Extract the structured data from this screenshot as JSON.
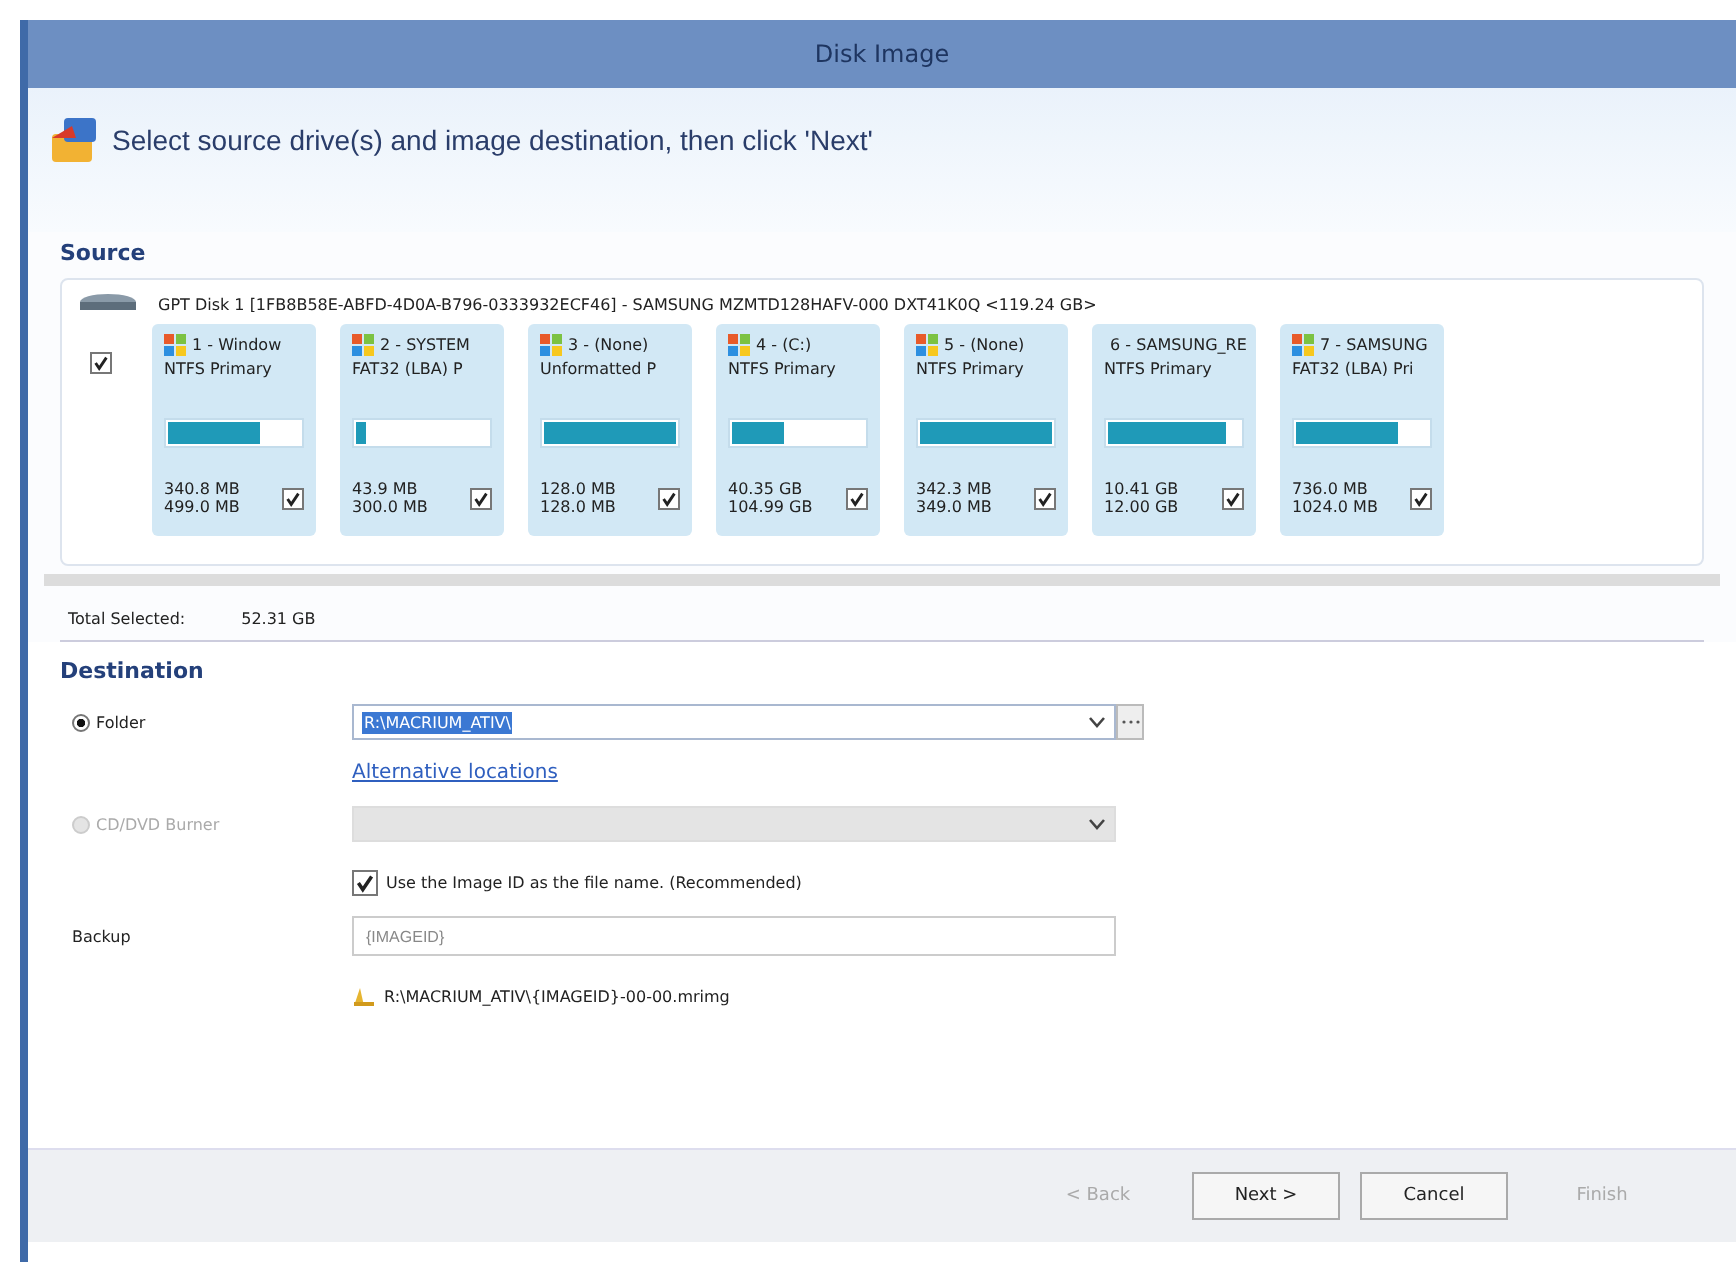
{
  "window": {
    "title": "Disk Image"
  },
  "header": {
    "instruction": "Select source drive(s) and image destination, then click 'Next'"
  },
  "source": {
    "heading": "Source",
    "disk": {
      "label": "GPT Disk 1 [1FB8B58E-ABFD-4D0A-B796-0333932ECF46] - SAMSUNG MZMTD128HAFV-000 DXT41K0Q  <119.24 GB>",
      "checked": true,
      "partitions": [
        {
          "name": "1 - Window",
          "type": "NTFS Primary",
          "level": 0.7,
          "used": "340.8 MB",
          "total": "499.0 MB",
          "checked": true
        },
        {
          "name": "2 - SYSTEM",
          "type": "FAT32 (LBA) P",
          "level": 0.08,
          "used": "43.9 MB",
          "total": "300.0 MB",
          "checked": true
        },
        {
          "name": "3 - (None)",
          "type": "Unformatted P",
          "level": 1,
          "used": "128.0 MB",
          "total": "128.0 MB",
          "checked": true
        },
        {
          "name": "4 - (C:)",
          "type": "NTFS Primary",
          "level": 0.4,
          "used": "40.35 GB",
          "total": "104.99 GB",
          "checked": true
        },
        {
          "name": "5 - (None)",
          "type": "NTFS Primary",
          "level": 1,
          "used": "342.3 MB",
          "total": "349.0 MB",
          "checked": true
        },
        {
          "name": "6 - SAMSUNG_RE",
          "type": "NTFS Primary",
          "level": 0.9,
          "used": "10.41 GB",
          "total": "12.00 GB",
          "checked": true
        },
        {
          "name": "7 - SAMSUNG",
          "type": "FAT32 (LBA) Pri",
          "level": 0.78,
          "used": "736.0 MB",
          "total": "1024.0 MB",
          "checked": true
        }
      ]
    },
    "total_label": "Total Selected:",
    "total_value": "52.31 GB"
  },
  "destination": {
    "heading": "Destination",
    "options": [
      {
        "label": "Folder",
        "selected": true,
        "disabled": false,
        "value": "R:\\MACRIUM_ATIV\\"
      },
      {
        "label": "CD/DVD Burner",
        "selected": false,
        "disabled": true
      }
    ],
    "alt_link": "Alternative locations",
    "use_image_id": {
      "label": "Use the Image ID as the file name.  (Recommended)",
      "checked": true
    },
    "backup_label": "Backup",
    "backup_placeholder": "{IMAGEID}",
    "result_path": "R:\\MACRIUM_ATIV\\{IMAGEID}-00-00.mrimg"
  },
  "buttons": [
    {
      "label": "< Back",
      "disabled": true
    },
    {
      "label": "Next >",
      "disabled": false
    },
    {
      "label": "Cancel",
      "disabled": false
    },
    {
      "label": "Finish",
      "disabled": true
    }
  ]
}
